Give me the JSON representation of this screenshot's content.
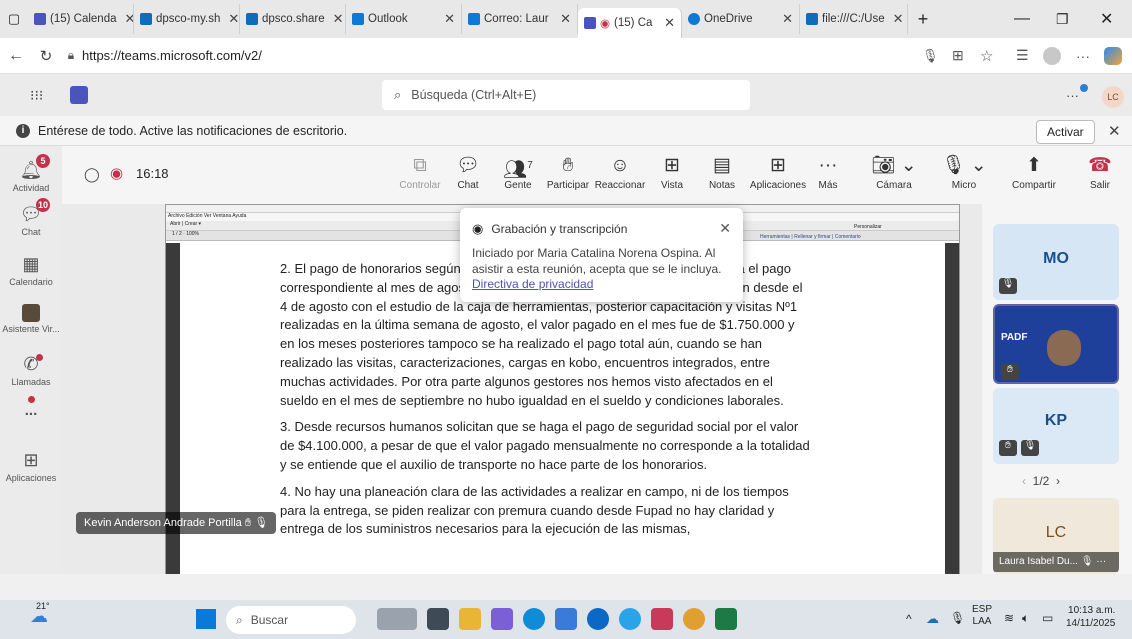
{
  "browser": {
    "tabs": [
      {
        "label": "(15) Calenda",
        "color": "#4b53bc"
      },
      {
        "label": "dpsco-my.sh",
        "color": "#0f6cbd"
      },
      {
        "label": "dpsco.share",
        "color": "#0f6cbd"
      },
      {
        "label": "Outlook",
        "color": "#0f78d4"
      },
      {
        "label": "Correo: Laur",
        "color": "#0f78d4"
      },
      {
        "label": "(15) Ca",
        "color": "#4b53bc"
      },
      {
        "label": "OneDrive",
        "color": "#0f78d4"
      },
      {
        "label": "file:///C:/Use",
        "color": "#0f6cbd"
      }
    ],
    "url": "https://teams.microsoft.com/v2/"
  },
  "teams": {
    "search_placeholder": "Búsqueda (Ctrl+Alt+E)",
    "user_initials": "LC"
  },
  "notification": {
    "text": "Entérese de todo. Active las notificaciones de escritorio.",
    "action": "Activar"
  },
  "rail": [
    {
      "label": "Actividad",
      "badge": "5"
    },
    {
      "label": "Chat",
      "badge": "10"
    },
    {
      "label": "Calendario",
      "badge": ""
    },
    {
      "label": "Asistente Vir...",
      "badge": ""
    },
    {
      "label": "Llamadas",
      "badge": ""
    },
    {
      "label": "...",
      "badge": ""
    },
    {
      "label": "Aplicaciones",
      "badge": ""
    }
  ],
  "meeting": {
    "timer": "16:18",
    "toolbar": {
      "controlar": "Controlar",
      "chat": "Chat",
      "gente": "Gente",
      "gente_count": "7",
      "participar": "Participar",
      "reaccionar": "Reaccionar",
      "vista": "Vista",
      "notas": "Notas",
      "aplicaciones": "Aplicaciones",
      "mas": "Más",
      "camara": "Cámara",
      "micro": "Micro",
      "compartir": "Compartir",
      "salir": "Salir"
    },
    "presenter": "Kevin Anderson Andrade Portilla"
  },
  "popup": {
    "title": "Grabación y transcripción",
    "body": "Iniciado por Maria Catalina Norena Ospina. Al asistir a esta reunión, acepta que se le incluya.",
    "link": "Directiva de privacidad"
  },
  "pdf": {
    "menu": [
      "Archivo",
      "Edición",
      "Ver",
      "Ventana",
      "Ayuda"
    ],
    "open": "Abrir",
    "create": "Crear",
    "zoom": "100%",
    "right_tabs": [
      "Herramientas",
      "Rellenar y firmar",
      "Comentario"
    ],
    "personalize": "Personalizar",
    "page": "1",
    "pages": "/ 2",
    "paragraphs": [
      "2. El pago de honorarios según es hasta por un valor de $3.500.0 valor que para el pago correspondiente al mes de agosto fue inferior pese a que las actividades iniciaron desde el 4 de agosto con el estudio de la caja de herramientas, posterior capacitación y visitas Nº1 realizadas en la última semana de agosto, el valor pagado en el mes fue de $1.750.000 y en los meses posteriores tampoco se ha realizado el pago total aún, cuando se han realizado las visitas, caracterizaciones, cargas en kobo, encuentros integrados, entre muchas actividades. Por otra parte algunos gestores nos hemos visto afectados en el sueldo en el mes de septiembre no hubo igualdad en el sueldo y condiciones laborales.",
      "3. Desde recursos humanos solicitan que se haga el pago de seguridad social por el valor de $4.100.000, a pesar de que el valor pagado mensualmente no corresponde a la totalidad y se entiende que el auxilio de transporte no hace parte de los honorarios.",
      "4. No hay una planeación clara de las actividades a realizar en campo, ni de los tiempos para la entrega, se piden realizar con premura cuando desde Fupad no hay claridad y entrega de los suministros necesarios para la ejecución de las mismas,"
    ]
  },
  "participants": {
    "tiles": [
      {
        "initials": "MO",
        "color": "#d6e6f5"
      },
      {
        "logo": "PADF",
        "color": "#1e3f9a"
      },
      {
        "initials": "KP",
        "color": "#dbe8f6"
      },
      {
        "initials": "LC",
        "color": "#f0e8da",
        "name": "Laura Isabel Du..."
      }
    ],
    "pager": "1/2"
  },
  "taskbar": {
    "temperature": "21°",
    "search": "Buscar",
    "lang": "ESP",
    "lang2": "LAA",
    "time": "10:13 a.m.",
    "date": "14/11/2025"
  }
}
